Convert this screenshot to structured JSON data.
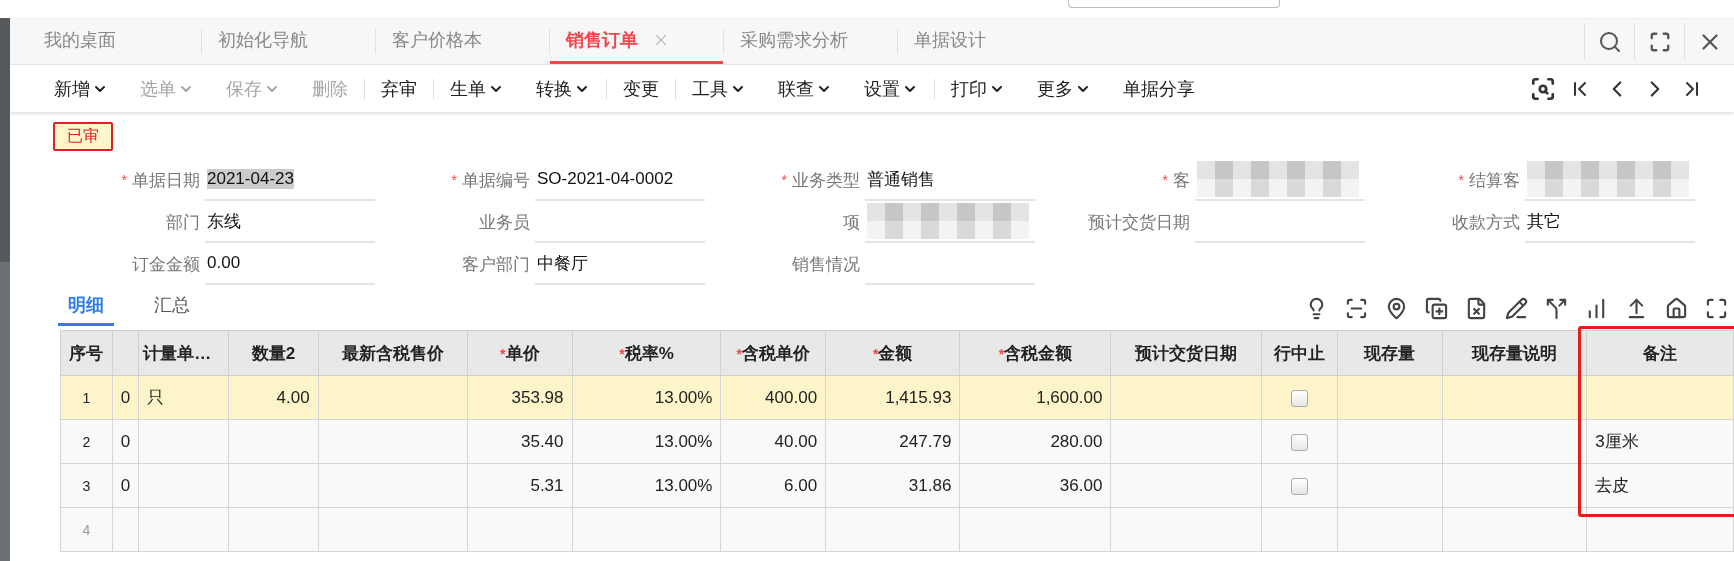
{
  "tabs": [
    {
      "label": "我的桌面",
      "selected": false,
      "closable": false
    },
    {
      "label": "初始化导航",
      "selected": false,
      "closable": false
    },
    {
      "label": "客户价格本",
      "selected": false,
      "closable": false
    },
    {
      "label": "销售订单",
      "selected": true,
      "closable": true
    },
    {
      "label": "采购需求分析",
      "selected": false,
      "closable": false
    },
    {
      "label": "单据设计",
      "selected": false,
      "closable": false
    }
  ],
  "toolbar": [
    {
      "label": "新增",
      "dropdown": true,
      "disabled": false,
      "divider_after": false
    },
    {
      "label": "选单",
      "dropdown": true,
      "disabled": true,
      "divider_after": false
    },
    {
      "label": "保存",
      "dropdown": true,
      "disabled": true,
      "divider_after": false
    },
    {
      "label": "删除",
      "dropdown": false,
      "disabled": true,
      "divider_after": true
    },
    {
      "label": "弃审",
      "dropdown": false,
      "disabled": false,
      "divider_after": true
    },
    {
      "label": "生单",
      "dropdown": true,
      "disabled": false,
      "divider_after": false
    },
    {
      "label": "转换",
      "dropdown": true,
      "disabled": false,
      "divider_after": true
    },
    {
      "label": "变更",
      "dropdown": false,
      "disabled": false,
      "divider_after": true
    },
    {
      "label": "工具",
      "dropdown": true,
      "disabled": false,
      "divider_after": false
    },
    {
      "label": "联查",
      "dropdown": true,
      "disabled": false,
      "divider_after": false
    },
    {
      "label": "设置",
      "dropdown": true,
      "disabled": false,
      "divider_after": true
    },
    {
      "label": "打印",
      "dropdown": true,
      "disabled": false,
      "divider_after": false
    },
    {
      "label": "更多",
      "dropdown": true,
      "disabled": false,
      "divider_after": false
    },
    {
      "label": "单据分享",
      "dropdown": false,
      "disabled": false,
      "divider_after": false
    }
  ],
  "status_badge": "已审",
  "form": [
    {
      "label": "单据日期",
      "required_mark": "*",
      "value": "2021-04-23",
      "highlighted": true
    },
    {
      "label": "单据编号",
      "required_mark": "*",
      "value": "SO-2021-04-0002"
    },
    {
      "label": "业务类型",
      "required_mark": "*",
      "value": "普通销售"
    },
    {
      "label": "客",
      "required_mark": "*",
      "blurred": true
    },
    {
      "label": "结算客",
      "required_mark": "*",
      "blurred": true
    },
    {
      "label": "部门",
      "value": "东线"
    },
    {
      "label": "业务员"
    },
    {
      "label": "项",
      "blurred": true
    },
    {
      "label": "预计交货日期"
    },
    {
      "label": "收款方式",
      "value": "其它"
    },
    {
      "label": "订金金额",
      "value": "0.00"
    },
    {
      "label": "客户部门",
      "value": "中餐厅"
    },
    {
      "label": "销售情况"
    }
  ],
  "detail_tabs": [
    {
      "label": "明细",
      "selected": true
    },
    {
      "label": "汇总",
      "selected": false
    }
  ],
  "table": {
    "columns": [
      {
        "label": "序号"
      },
      {},
      {
        "label": "计量单…"
      },
      {
        "label": "数量2"
      },
      {
        "label": "最新含税售价"
      },
      {
        "label": "单价",
        "required_mark": "*"
      },
      {
        "label": "税率%",
        "required_mark": "*"
      },
      {
        "label": "含税单价",
        "required_mark": "*"
      },
      {
        "label": "金额",
        "required_mark": "*"
      },
      {
        "label": "含税金额",
        "required_mark": "*"
      },
      {
        "label": "预计交货日期"
      },
      {
        "label": "行中止"
      },
      {
        "label": "现存量"
      },
      {
        "label": "现存量说明"
      },
      {
        "label": "备注",
        "highlighted": true
      }
    ],
    "rows": [
      {
        "selected": true,
        "disabled": false,
        "stopped": false,
        "cells": [
          "1",
          "0",
          "只",
          "4.00",
          "",
          "353.98",
          "13.00%",
          "400.00",
          "1,415.93",
          "1,600.00",
          "",
          "",
          "",
          "",
          ""
        ]
      },
      {
        "selected": false,
        "disabled": false,
        "stopped": false,
        "cells": [
          "2",
          "0",
          "",
          "",
          "",
          "35.40",
          "13.00%",
          "40.00",
          "247.79",
          "280.00",
          "",
          "",
          "",
          "",
          "3厘米"
        ]
      },
      {
        "selected": false,
        "disabled": false,
        "stopped": false,
        "cells": [
          "3",
          "0",
          "",
          "",
          "",
          "5.31",
          "13.00%",
          "6.00",
          "31.86",
          "36.00",
          "",
          "",
          "",
          "",
          "去皮"
        ]
      },
      {
        "selected": false,
        "disabled": true,
        "cells": [
          "4",
          "",
          "",
          "",
          "",
          "",
          "",
          "",
          "",
          "",
          "",
          "",
          "",
          "",
          ""
        ]
      }
    ]
  }
}
